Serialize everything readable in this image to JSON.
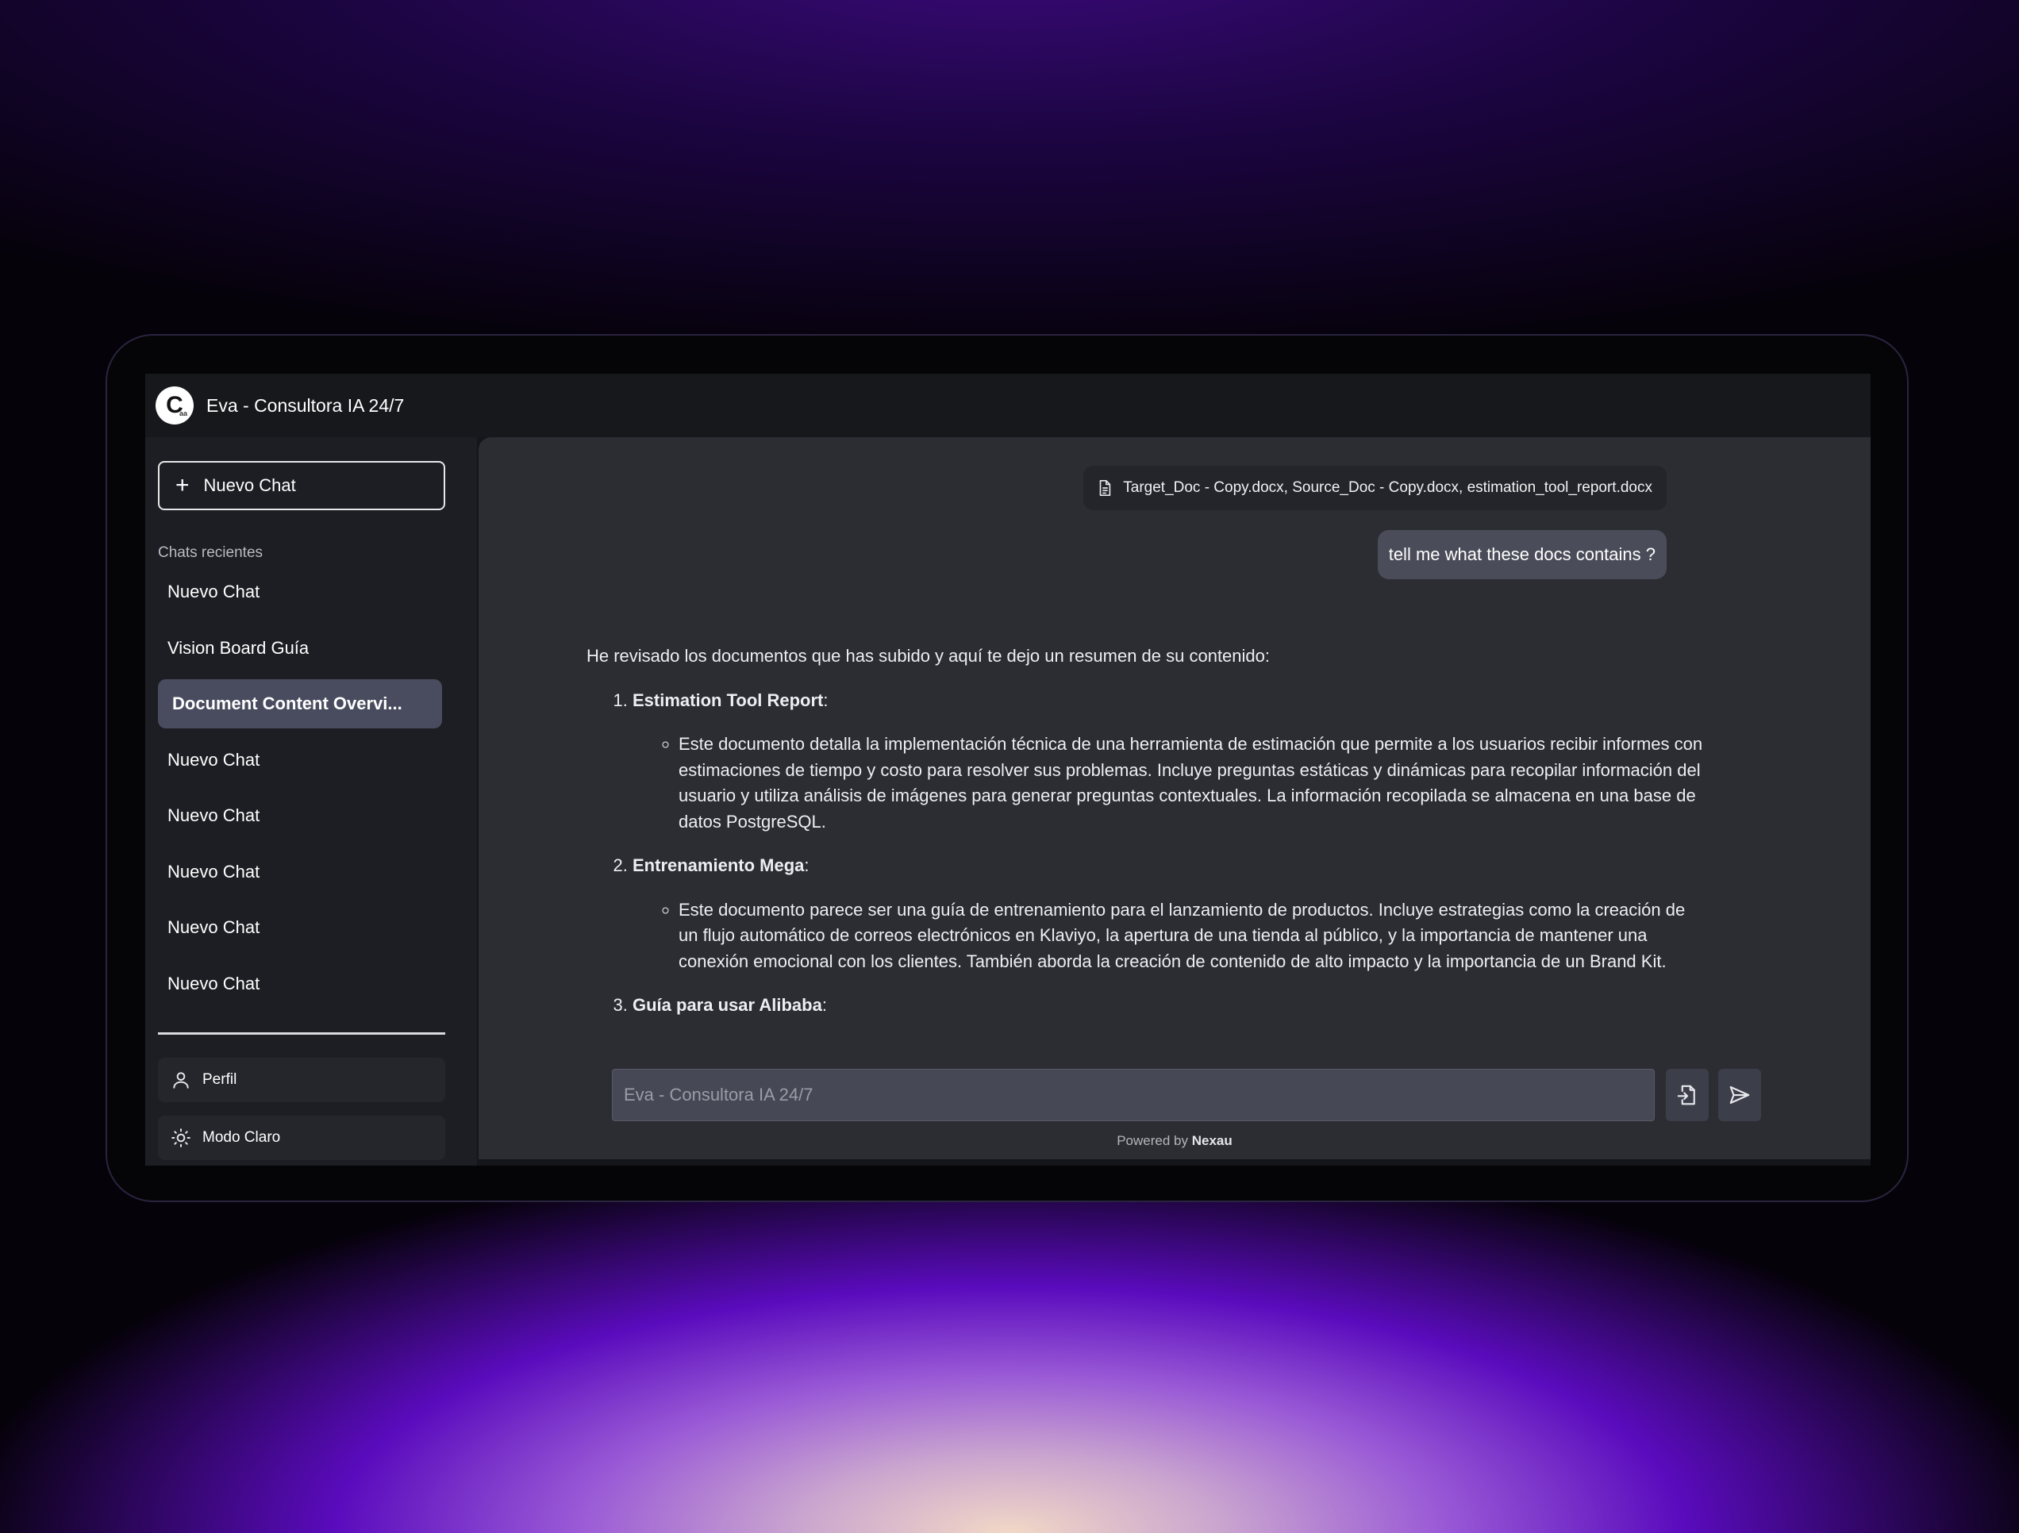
{
  "app": {
    "logo_letter": "C",
    "logo_sub": "aa",
    "title": "Eva - Consultora IA 24/7"
  },
  "sidebar": {
    "new_chat_label": "Nuevo Chat",
    "recent_label": "Chats recientes",
    "chats": [
      {
        "label": "Nuevo Chat",
        "active": false
      },
      {
        "label": "Vision Board Guía",
        "active": false
      },
      {
        "label": "Document Content Overvi...",
        "active": true
      },
      {
        "label": "Nuevo Chat",
        "active": false
      },
      {
        "label": "Nuevo Chat",
        "active": false
      },
      {
        "label": "Nuevo Chat",
        "active": false
      },
      {
        "label": "Nuevo Chat",
        "active": false
      },
      {
        "label": "Nuevo Chat",
        "active": false
      }
    ],
    "profile_label": "Perfil",
    "theme_label": "Modo Claro"
  },
  "conversation": {
    "attachments": "Target_Doc - Copy.docx, Source_Doc - Copy.docx, estimation_tool_report.docx",
    "user_message": "tell me what these docs contains ?",
    "intro": "He revisado los documentos que has subido y aquí te dejo un resumen de su contenido:",
    "items": [
      {
        "title": "Estimation Tool Report",
        "description": "Este documento detalla la implementación técnica de una herramienta de estimación que permite a los usuarios recibir informes con estimaciones de tiempo y costo para resolver sus problemas. Incluye preguntas estáticas y dinámicas para recopilar información del usuario y utiliza análisis de imágenes para generar preguntas contextuales. La información recopilada se almacena en una base de datos PostgreSQL."
      },
      {
        "title": "Entrenamiento Mega",
        "description": "Este documento parece ser una guía de entrenamiento para el lanzamiento de productos. Incluye estrategias como la creación de un flujo automático de correos electrónicos en Klaviyo, la apertura de una tienda al público, y la importancia de mantener una conexión emocional con los clientes. También aborda la creación de contenido de alto impacto y la importancia de un Brand Kit."
      },
      {
        "title": "Guía para usar Alibaba",
        "description": ""
      }
    ]
  },
  "composer": {
    "placeholder": "Eva - Consultora IA 24/7",
    "value": ""
  },
  "footer": {
    "powered_prefix": "Powered by",
    "powered_brand": "Nexau"
  },
  "icons": {
    "attachment": "document-icon",
    "upload": "file-import-icon",
    "send": "send-icon",
    "profile": "user-icon",
    "theme": "sun-icon"
  },
  "colors": {
    "sidebar_bg": "#1d1e23",
    "main_bg": "#2c2d33",
    "active_chat": "#484c5e",
    "user_bubble": "#4a4d59"
  }
}
